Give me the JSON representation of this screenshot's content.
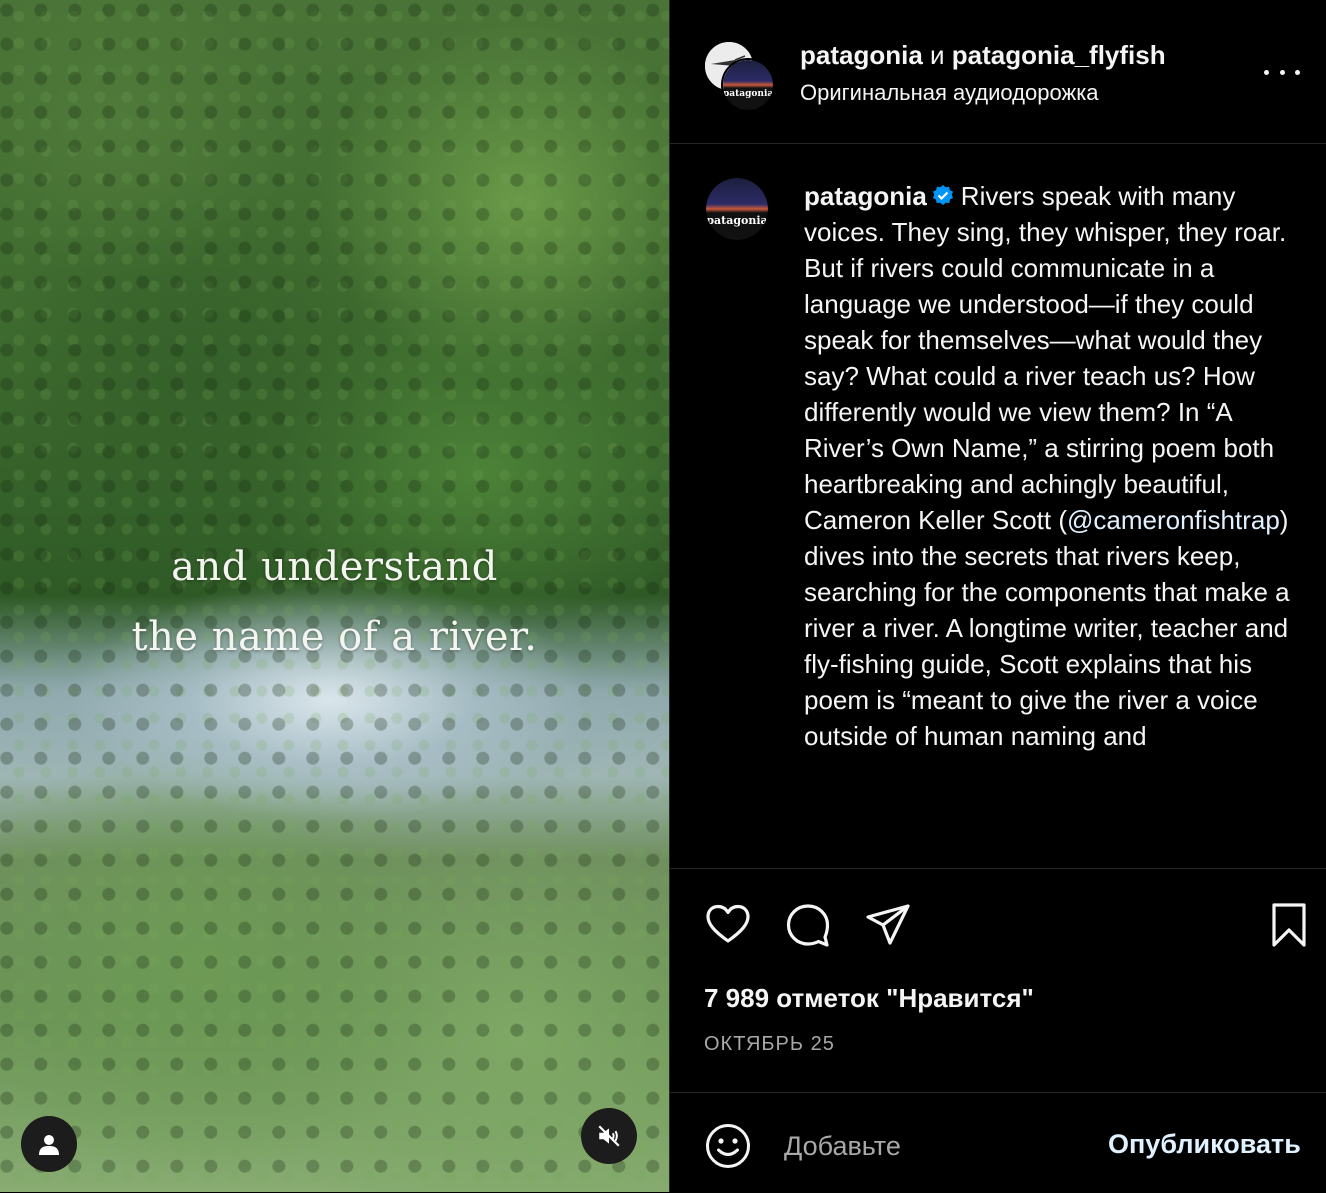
{
  "media": {
    "overlay_line_1": "and understand",
    "overlay_line_2": "the name of a river.",
    "user_icon": "user-icon",
    "mute_icon": "speaker-muted-icon"
  },
  "header": {
    "user_1": "patagonia",
    "conjunction": "и",
    "user_2": "patagonia_flyfish",
    "audio": "Оригинальная аудиодорожка",
    "avatar_logo_text": "patagonia",
    "more_icon": "more-icon"
  },
  "caption": {
    "username": "patagonia",
    "verified_icon": "verified-badge-icon",
    "text_before_mention": "Rivers speak with many voices. They sing, they whisper, they roar. But if rivers could communicate in a language we understood—if they could speak for themselves—what would they say? What could a river teach us? How differently would we view them? In “A River’s Own Name,” a stirring poem both heartbreaking and achingly beautiful, Cameron Keller Scott (",
    "mention": "@cameronfishtrap",
    "text_after_mention": ") dives into the secrets that rivers keep, searching for the components that make a river a river. A longtime writer, teacher and fly-fishing guide, Scott explains that his poem is “meant to give the river a voice outside of human naming and"
  },
  "actions": {
    "like_icon": "heart-icon",
    "comment_icon": "comment-icon",
    "share_icon": "send-icon",
    "save_icon": "bookmark-icon",
    "likes": "7 989 отметок \"Нравится\"",
    "date": "ОКТЯБРЬ 25"
  },
  "comment": {
    "emoji_icon": "emoji-icon",
    "placeholder": "Добавьте",
    "post_label": "Опубликовать"
  },
  "colors": {
    "background": "#000000",
    "text": "#f5f5f5",
    "secondary_text": "#a8a8a8",
    "link": "#e0f1ff",
    "verified": "#0095f6"
  }
}
